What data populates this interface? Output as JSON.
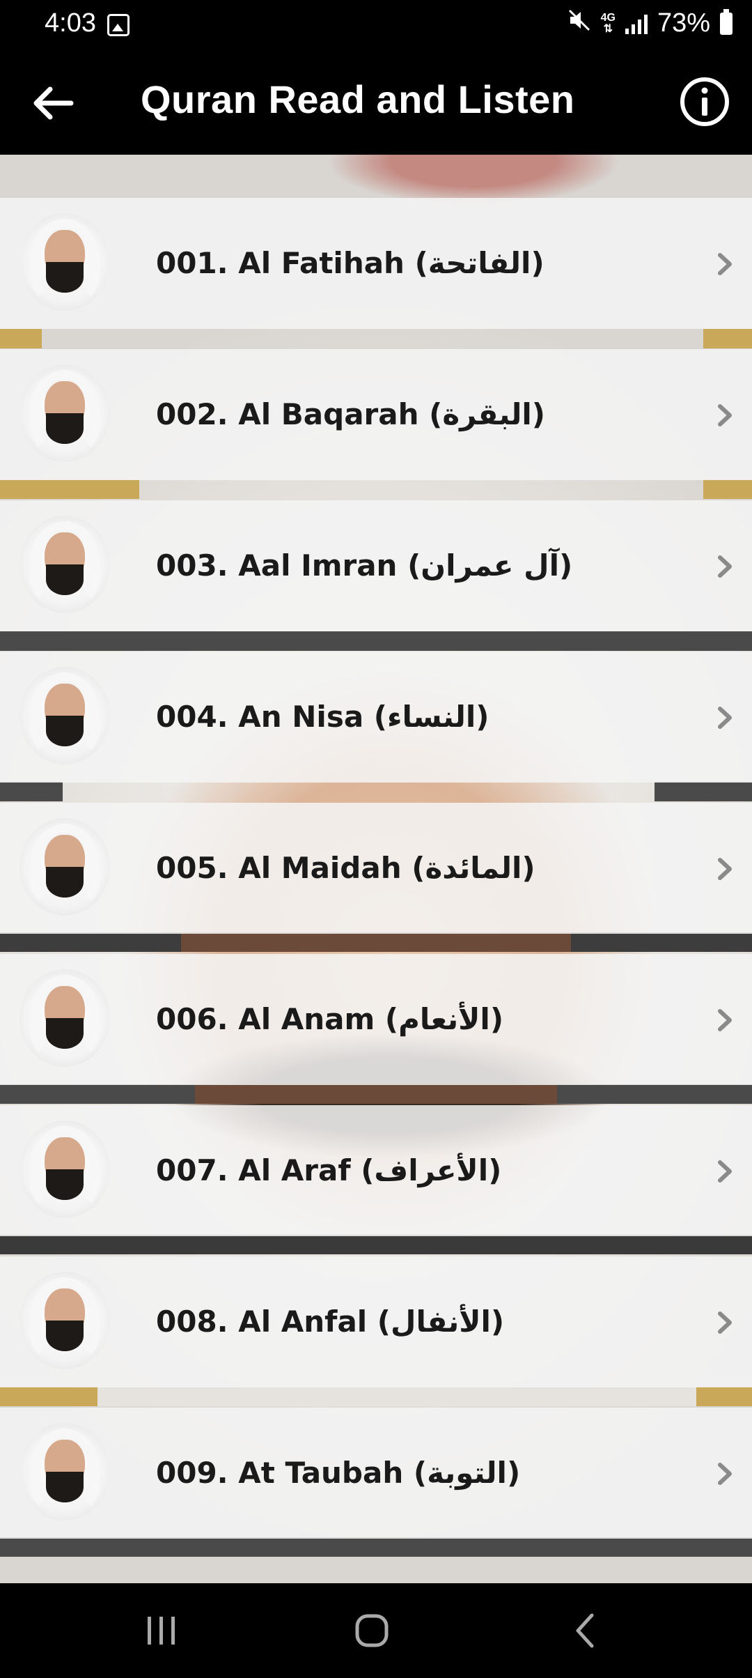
{
  "status_bar": {
    "time": "4:03",
    "network": "4G",
    "battery": "73%",
    "icons": [
      "gallery-icon",
      "mute-icon",
      "4g-icon",
      "signal-icon",
      "battery-icon"
    ]
  },
  "app_bar": {
    "title": "Quran Read and Listen",
    "back_icon": "arrow-left-icon",
    "info_icon": "info-icon"
  },
  "surahs": [
    {
      "label": "001. Al Fatihah (الفاتحة)"
    },
    {
      "label": "002. Al Baqarah (البقرة)"
    },
    {
      "label": "003. Aal Imran (آل عمران)"
    },
    {
      "label": "004. An Nisa (النساء)"
    },
    {
      "label": "005. Al Maidah (المائدة)"
    },
    {
      "label": "006. Al Anam (الأنعام)"
    },
    {
      "label": "007. Al Araf (الأعراف)"
    },
    {
      "label": "008. Al Anfal (الأنفال)"
    },
    {
      "label": "009. At Taubah (التوبة)"
    }
  ],
  "nav_bar": {
    "icons": [
      "recent-apps-icon",
      "home-icon",
      "back-icon"
    ]
  },
  "colors": {
    "bar_background": "#000000",
    "row_background": "#f5f5f5",
    "text": "#1a1a1a",
    "chevron": "#8a8a8a"
  }
}
